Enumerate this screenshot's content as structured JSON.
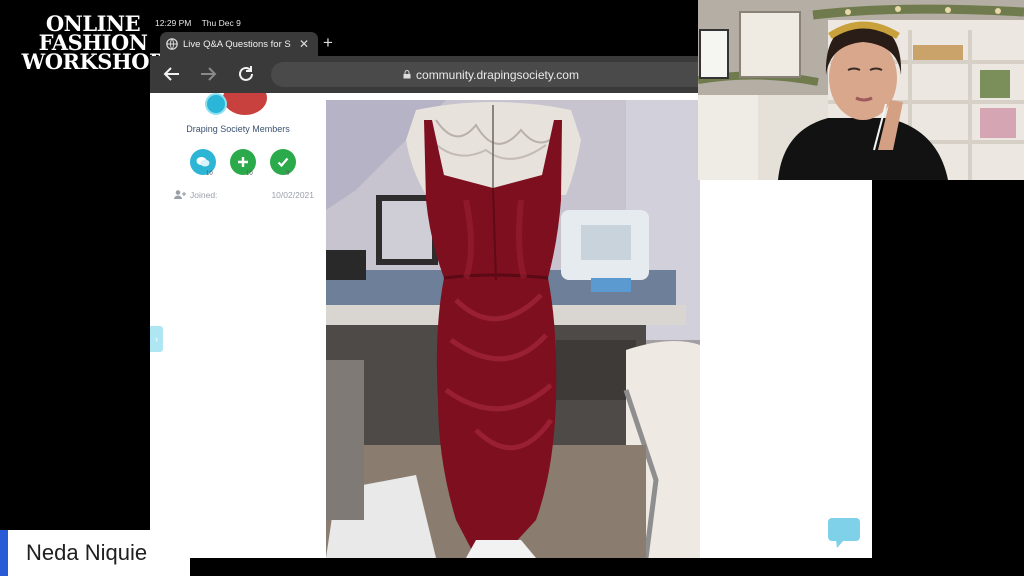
{
  "logo": {
    "line1": "ONLINE",
    "line2": "FASHION",
    "line3": "WORKSHOP"
  },
  "status_bar": {
    "time": "12:29 PM",
    "date": "Thu Dec 9"
  },
  "browser": {
    "tab_title": "Live Q&A Questions for S",
    "url": "community.drapingsociety.com"
  },
  "profile": {
    "group": "Draping Society Members",
    "stats": [
      {
        "icon": "chat-bubbles-icon",
        "count": "10"
      },
      {
        "icon": "plus-icon",
        "count": "10"
      },
      {
        "icon": "check-icon",
        "count": "0"
      }
    ],
    "joined_label": "Joined:",
    "joined_date": "10/02/2021"
  },
  "presenter": {
    "name": "Neda Niquie"
  },
  "colors": {
    "dress": "#7e0f1e",
    "accent_blue": "#2db5d5",
    "accent_green": "#2aaa4a",
    "name_strip_accent": "#2a5bd7",
    "chrome": "#3a3a3a"
  }
}
